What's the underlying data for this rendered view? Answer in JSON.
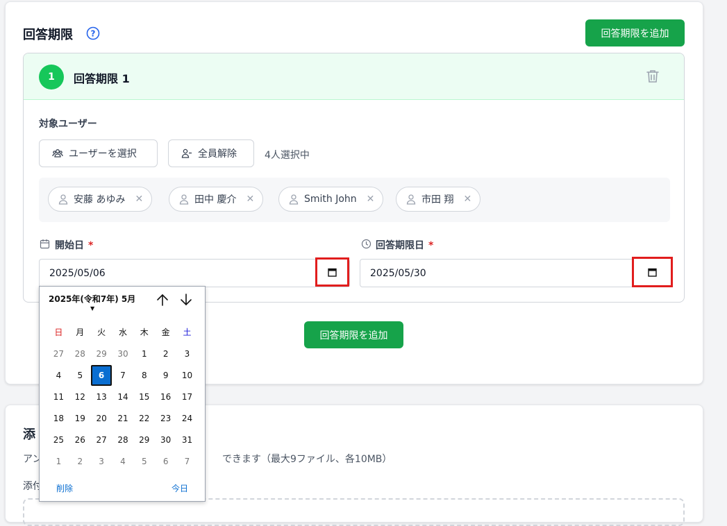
{
  "section": {
    "title": "回答期限",
    "add_label": "回答期限を追加"
  },
  "period": {
    "number": "1",
    "title": "回答期限 1",
    "target_users_label": "対象ユーザー",
    "select_users_label": "ユーザーを選択",
    "clear_all_label": "全員解除",
    "selected_count": "4人選択中",
    "chips": [
      {
        "name": "安藤 あゆみ"
      },
      {
        "name": "田中 慶介"
      },
      {
        "name": "Smith John"
      },
      {
        "name": "市田 翔"
      }
    ],
    "start_label": "開始日",
    "start_value": "2025/05/06",
    "deadline_label": "回答期限日",
    "deadline_value": "2025/05/30",
    "required_mark": "*"
  },
  "add_bottom_label": "回答期限を追加",
  "attachments": {
    "title_visible": "添",
    "desc_left": "アン",
    "desc_right": "できます（最大9ファイル、各10MB）",
    "label_visible": "添付"
  },
  "datepicker": {
    "month_label": "2025年(令和7年) 5月",
    "weekdays": [
      "日",
      "月",
      "火",
      "水",
      "木",
      "金",
      "土"
    ],
    "weeks": [
      [
        "27",
        "28",
        "29",
        "30",
        "1",
        "2",
        "3"
      ],
      [
        "4",
        "5",
        "6",
        "7",
        "8",
        "9",
        "10"
      ],
      [
        "11",
        "12",
        "13",
        "14",
        "15",
        "16",
        "17"
      ],
      [
        "18",
        "19",
        "20",
        "21",
        "22",
        "23",
        "24"
      ],
      [
        "25",
        "26",
        "27",
        "28",
        "29",
        "30",
        "31"
      ],
      [
        "1",
        "2",
        "3",
        "4",
        "5",
        "6",
        "7"
      ]
    ],
    "selected_day": "6",
    "clear_label": "削除",
    "today_label": "今日"
  },
  "colors": {
    "accent_green": "#16a34a",
    "badge_green": "#16c75a",
    "highlight_red": "#e11d1d",
    "selected_blue": "#0a6ed1"
  }
}
